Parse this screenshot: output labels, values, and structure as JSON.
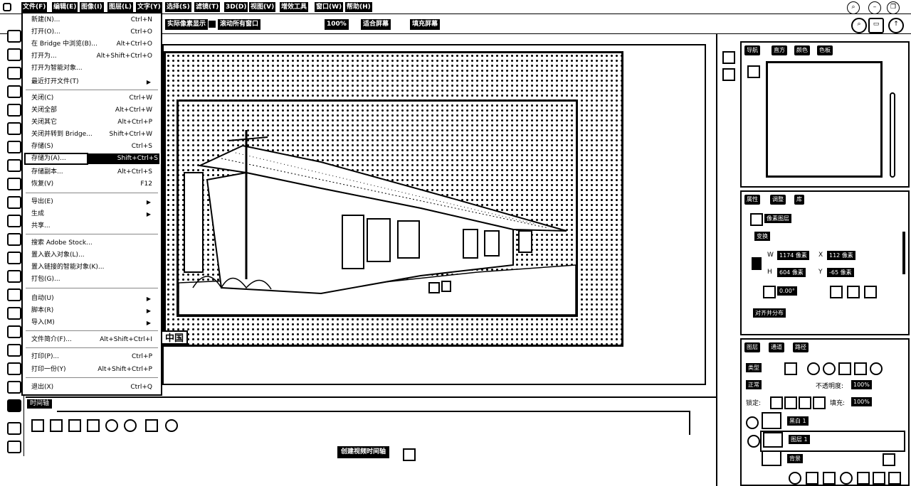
{
  "menubar": {
    "items": [
      "文件(F)",
      "编辑(E)",
      "图像(I)",
      "图层(L)",
      "文字(Y)",
      "选择(S)",
      "滤镜(T)",
      "3D(D)",
      "视图(V)",
      "增效工具",
      "窗口(W)",
      "帮助(H)"
    ]
  },
  "optbar": {
    "fit_label": "实际像素显示",
    "scroll_all": "滚动所有窗口",
    "zoom": "100%",
    "fit_screen": "适合屏幕",
    "fill_screen": "填充屏幕"
  },
  "file_menu": [
    {
      "label": "新建(N)...",
      "shortcut": "Ctrl+N"
    },
    {
      "label": "打开(O)...",
      "shortcut": "Ctrl+O"
    },
    {
      "label": "在 Bridge 中浏览(B)...",
      "shortcut": "Alt+Ctrl+O"
    },
    {
      "label": "打开为...",
      "shortcut": "Alt+Shift+Ctrl+O"
    },
    {
      "label": "打开为智能对象...",
      "shortcut": ""
    },
    {
      "label": "最近打开文件(T)",
      "shortcut": ""
    },
    {
      "label": "关闭(C)",
      "shortcut": "Ctrl+W"
    },
    {
      "label": "关闭全部",
      "shortcut": "Alt+Ctrl+W"
    },
    {
      "label": "关闭其它",
      "shortcut": "Alt+Ctrl+P"
    },
    {
      "label": "关闭并转到 Bridge...",
      "shortcut": "Shift+Ctrl+W"
    },
    {
      "label": "存储(S)",
      "shortcut": "Ctrl+S"
    },
    {
      "label": "存储为(A)...",
      "shortcut": "Shift+Ctrl+S"
    },
    {
      "label": "存储副本...",
      "shortcut": "Alt+Ctrl+S"
    },
    {
      "label": "恢复(V)",
      "shortcut": "F12"
    },
    {
      "label": "导出(E)",
      "shortcut": ""
    },
    {
      "label": "生成",
      "shortcut": ""
    },
    {
      "label": "共享...",
      "shortcut": ""
    },
    {
      "label": "搜索 Adobe Stock...",
      "shortcut": ""
    },
    {
      "label": "置入嵌入对象(L)...",
      "shortcut": ""
    },
    {
      "label": "置入链接的智能对象(K)...",
      "shortcut": ""
    },
    {
      "label": "打包(G)...",
      "shortcut": ""
    },
    {
      "label": "自动(U)",
      "shortcut": ""
    },
    {
      "label": "脚本(R)",
      "shortcut": ""
    },
    {
      "label": "导入(M)",
      "shortcut": ""
    },
    {
      "label": "文件简介(F)...",
      "shortcut": "Alt+Shift+Ctrl+I"
    },
    {
      "label": "打印(P)...",
      "shortcut": "Ctrl+P"
    },
    {
      "label": "打印一份(Y)",
      "shortcut": "Alt+Shift+Ctrl+P"
    },
    {
      "label": "退出(X)",
      "shortcut": "Ctrl+Q"
    }
  ],
  "canvas": {
    "subtitle": "中国"
  },
  "timeline": {
    "tab": "时间轴",
    "create_button": "创建视频时间轴"
  },
  "navigator": {
    "tabs": [
      "导航",
      "直方",
      "颜色",
      "色板"
    ]
  },
  "properties": {
    "tabs": [
      "属性",
      "调整",
      "库"
    ],
    "title": "像素图层",
    "section": "变换",
    "w_label": "W",
    "w_value": "1174 像素",
    "h_label": "H",
    "h_value": "604 像素",
    "x_label": "X",
    "x_value": "112 像素",
    "y_label": "Y",
    "y_value": "-65 像素",
    "angle": "0.00°",
    "flip_button": "对齐并分布"
  },
  "layers": {
    "tabs": [
      "图层",
      "通道",
      "路径"
    ],
    "filter": "类型",
    "blend": "正常",
    "opacity_label": "不透明度:",
    "opacity": "100%",
    "lock_label": "锁定:",
    "fill_label": "填充:",
    "fill": "100%",
    "items": [
      {
        "name": "黑白 1"
      },
      {
        "name": "图层 1"
      },
      {
        "name": "背景"
      }
    ]
  }
}
